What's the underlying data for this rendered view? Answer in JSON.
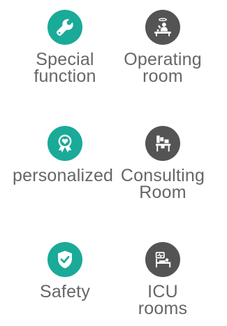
{
  "features": [
    {
      "lines": [
        "Special",
        "function"
      ],
      "icon": "wrench-icon",
      "color": "#1aaa98"
    },
    {
      "lines": [
        "Operating",
        "room"
      ],
      "icon": "surgeon-icon",
      "color": "#545454"
    },
    {
      "lines": [
        "personalized"
      ],
      "icon": "award-ribbon-heart-icon",
      "color": "#1aaa98"
    },
    {
      "lines": [
        "Consulting",
        "Room"
      ],
      "icon": "doctor-desk-icon",
      "color": "#545454"
    },
    {
      "lines": [
        "Safety"
      ],
      "icon": "shield-check-icon",
      "color": "#1aaa98"
    },
    {
      "lines": [
        "ICU",
        "rooms"
      ],
      "icon": "hospital-bed-monitor-icon",
      "color": "#545454"
    }
  ]
}
